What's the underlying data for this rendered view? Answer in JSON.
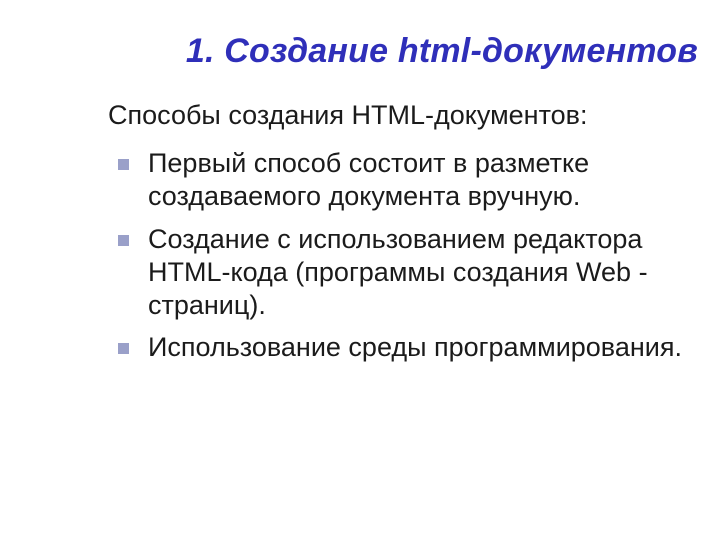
{
  "title": "1. Создание html-документов",
  "intro": "Способы создания HTML-документов:",
  "bullets": [
    "Первый способ состоит в разметке создаваемого документа вручную.",
    "Создание с использованием редактора HTML-кода (программы создания Web - страниц).",
    "Использование среды программирования."
  ]
}
